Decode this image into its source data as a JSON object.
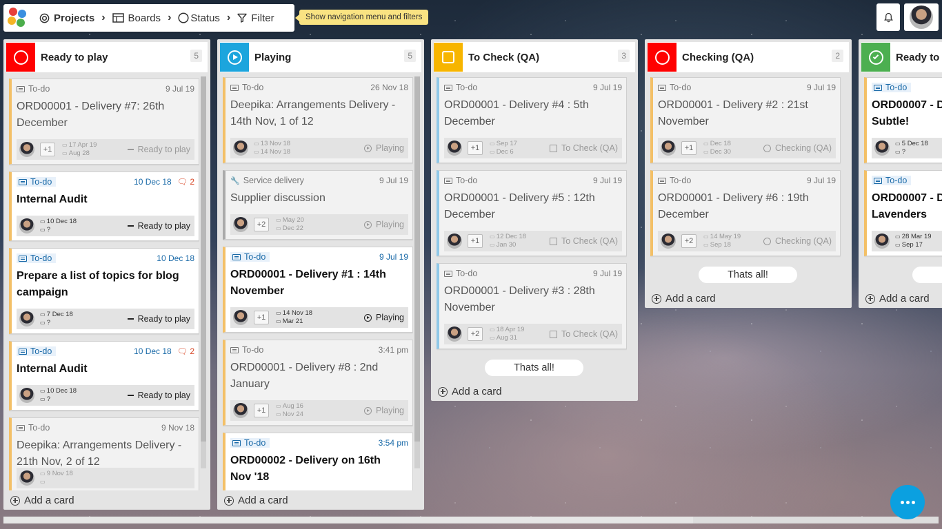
{
  "topbar": {
    "projects": "Projects",
    "boards": "Boards",
    "status": "Status",
    "filter": "Filter",
    "tooltip": "Show navigation menu and filters"
  },
  "colors": {
    "red": "#ff0000",
    "blue": "#1ca5dd",
    "yellow": "#f7b500",
    "green": "#4caf50"
  },
  "columns": [
    {
      "title": "Ready to play",
      "count": "5",
      "color": "#ff0000",
      "icon": "circle-icon",
      "add": "Add a card",
      "cards": [
        {
          "tag": "To-do",
          "date": "9 Jul 19",
          "title": "ORD00001 - Delivery #7: 26th December",
          "plus": "+1",
          "d1": "17 Apr 19",
          "d2": "Aug 28",
          "state": "Ready to play",
          "active": false
        },
        {
          "tag": "To-do",
          "date": "10 Dec 18",
          "comments": "2",
          "title": "Internal Audit",
          "d1": "10 Dec 18",
          "d2": "?",
          "state": "Ready to play",
          "active": true
        },
        {
          "tag": "To-do",
          "date": "10 Dec 18",
          "title": "Prepare a list of topics for blog campaign",
          "d1": "7 Dec 18",
          "d2": "?",
          "state": "Ready to play",
          "active": true
        },
        {
          "tag": "To-do",
          "date": "10 Dec 18",
          "comments": "2",
          "title": "Internal Audit",
          "d1": "10 Dec 18",
          "d2": "?",
          "state": "Ready to play",
          "active": true
        },
        {
          "tag": "To-do",
          "date": "9 Nov 18",
          "title": "Deepika: Arrangements Delivery - 21th Nov, 2 of 12",
          "d1": "9 Nov 18",
          "d2": "",
          "state": "",
          "active": false
        }
      ]
    },
    {
      "title": "Playing",
      "count": "5",
      "color": "#1ca5dd",
      "icon": "play-icon",
      "add": "Add a card",
      "cards": [
        {
          "tag": "To-do",
          "date": "26 Nov 18",
          "title": "Deepika: Arrangements Delivery - 14th Nov, 1 of 12",
          "d1": "13 Nov 18",
          "d2": "14 Nov 18",
          "state": "Playing",
          "active": false,
          "darkfoot": true
        },
        {
          "tag": "Service delivery",
          "date": "9 Jul 19",
          "title": "Supplier discussion",
          "plus": "+2",
          "d1": "May 20",
          "d2": "Dec 22",
          "state": "Playing",
          "active": false,
          "gray": true
        },
        {
          "tag": "To-do",
          "date": "9 Jul 19",
          "title": "ORD00001 - Delivery #1 : 14th November",
          "plus": "+1",
          "d1": "14 Nov 18",
          "d2": "Mar 21",
          "state": "Playing",
          "active": true
        },
        {
          "tag": "To-do",
          "date": "3:41 pm",
          "title": "ORD00001 - Delivery #8 : 2nd January",
          "plus": "+1",
          "d1": "Aug 16",
          "d2": "Nov 24",
          "state": "Playing",
          "active": false
        },
        {
          "tag": "To-do",
          "date": "3:54 pm",
          "title": "ORD00002 - Delivery on 16th Nov '18",
          "d1": "",
          "d2": "",
          "state": "",
          "active": true
        }
      ]
    },
    {
      "title": "To Check (QA)",
      "count": "3",
      "color": "#f7b500",
      "icon": "square-icon",
      "add": "Add a card",
      "thats": "Thats all!",
      "cards": [
        {
          "tag": "To-do",
          "date": "9 Jul 19",
          "title": "ORD00001 - Delivery #4 : 5th December",
          "plus": "+1",
          "d1": "Sep 17",
          "d2": "Dec 6",
          "state": "To Check (QA)",
          "active": false
        },
        {
          "tag": "To-do",
          "date": "9 Jul 19",
          "title": "ORD00001 - Delivery #5 : 12th December",
          "plus": "+1",
          "d1": "12 Dec 18",
          "d2": "Jan 30",
          "state": "To Check (QA)",
          "active": false
        },
        {
          "tag": "To-do",
          "date": "9 Jul 19",
          "title": "ORD00001 - Delivery #3 : 28th November",
          "plus": "+2",
          "d1": "18 Apr 19",
          "d2": "Aug 31",
          "state": "To Check (QA)",
          "active": false
        }
      ]
    },
    {
      "title": "Checking (QA)",
      "count": "2",
      "color": "#ff0000",
      "icon": "circle-icon",
      "add": "Add a card",
      "thats": "Thats all!",
      "cards": [
        {
          "tag": "To-do",
          "date": "9 Jul 19",
          "title": "ORD00001 - Delivery #2 : 21st November",
          "plus": "+1",
          "d1": "Dec 18",
          "d2": "Dec 30",
          "state": "Checking (QA)",
          "active": false
        },
        {
          "tag": "To-do",
          "date": "9 Jul 19",
          "title": "ORD00001 - Delivery #6 : 19th December",
          "plus": "+2",
          "d1": "14 May 19",
          "d2": "Sep 18",
          "state": "Checking (QA)",
          "active": false
        }
      ]
    },
    {
      "title": "Ready to",
      "count": "",
      "color": "#4caf50",
      "icon": "check-circle-icon",
      "add": "Add a card",
      "cards": [
        {
          "tag": "To-do",
          "date": "",
          "title": "ORD00007 - D Subtle!",
          "d1": "5 Dec 18",
          "d2": "?",
          "state": "",
          "active": true
        },
        {
          "tag": "To-do",
          "date": "",
          "title": "ORD00007 - D Lavenders",
          "d1": "28 Mar 19",
          "d2": "Sep 17",
          "state": "",
          "active": true
        }
      ]
    }
  ]
}
